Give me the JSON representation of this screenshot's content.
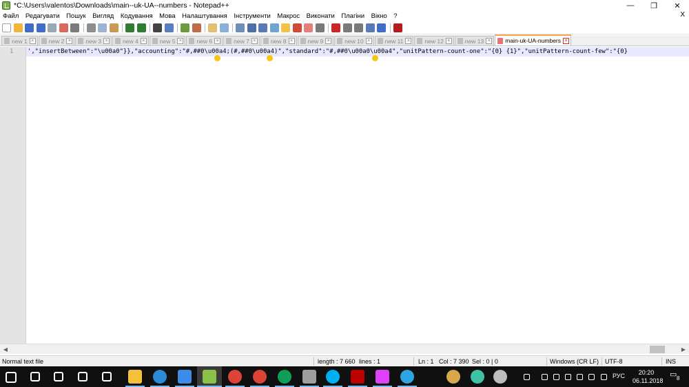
{
  "window": {
    "title": "*C:\\Users\\valentos\\Downloads\\main--uk-UA--numbers - Notepad++",
    "controls": [
      "—",
      "❐",
      "✕"
    ]
  },
  "menu": {
    "items": [
      "Файл",
      "Редагувати",
      "Пошук",
      "Вигляд",
      "Кодування",
      "Мова",
      "Налаштування",
      "Інструменти",
      "Макрос",
      "Виконати",
      "Плагіни",
      "Вікно",
      "?"
    ],
    "close": "X"
  },
  "toolbar": {
    "buttons": [
      {
        "name": "new-file-icon",
        "color": "#ffffff"
      },
      {
        "name": "open-file-icon",
        "color": "#f0b53c"
      },
      {
        "name": "save-icon",
        "color": "#3f6ec6"
      },
      {
        "name": "save-all-icon",
        "color": "#3f6ec6"
      },
      {
        "name": "close-icon",
        "color": "#9aa7b4"
      },
      {
        "name": "close-all-icon",
        "color": "#d96b5d"
      },
      {
        "name": "print-icon",
        "color": "#7a7a7a"
      },
      {
        "sep": true
      },
      {
        "name": "cut-icon",
        "color": "#8d8d8d"
      },
      {
        "name": "copy-icon",
        "color": "#9cb3d6"
      },
      {
        "name": "paste-icon",
        "color": "#c89a52"
      },
      {
        "sep": true
      },
      {
        "name": "undo-icon",
        "color": "#2e7d32"
      },
      {
        "name": "redo-icon",
        "color": "#2e7d32"
      },
      {
        "sep": true
      },
      {
        "name": "find-icon",
        "color": "#444444"
      },
      {
        "name": "replace-icon",
        "color": "#5a7fc0"
      },
      {
        "sep": true
      },
      {
        "name": "zoom-in-icon",
        "color": "#6d9a3a"
      },
      {
        "name": "zoom-out-icon",
        "color": "#c06a48"
      },
      {
        "sep": true
      },
      {
        "name": "sync-vertical-icon",
        "color": "#e3c070"
      },
      {
        "name": "sync-horizontal-icon",
        "color": "#8ab0d8"
      },
      {
        "sep": true
      },
      {
        "name": "word-wrap-icon",
        "color": "#6e8fb8"
      },
      {
        "name": "show-all-chars-icon",
        "color": "#4c6fa8"
      },
      {
        "name": "indent-guide-icon",
        "color": "#5a79b8"
      },
      {
        "name": "udl-icon",
        "color": "#6fa3d0"
      },
      {
        "name": "doc-map-icon",
        "color": "#f1c24a"
      },
      {
        "name": "function-list-icon",
        "color": "#d04a3a"
      },
      {
        "name": "folder-workspace-icon",
        "color": "#e77e7e"
      },
      {
        "name": "monitoring-icon",
        "color": "#7a7a7a"
      },
      {
        "sep": true
      },
      {
        "name": "record-macro-icon",
        "color": "#c62828"
      },
      {
        "name": "stop-macro-icon",
        "color": "#7a7a7a"
      },
      {
        "name": "play-macro-icon",
        "color": "#7a7a7a"
      },
      {
        "name": "play-multiple-icon",
        "color": "#5a79b8"
      },
      {
        "name": "save-macro-icon",
        "color": "#3f6ec6"
      },
      {
        "sep": true
      },
      {
        "name": "spellcheck-icon",
        "color": "#b71c1c"
      }
    ]
  },
  "tabs": [
    {
      "label": "new 1",
      "active": false
    },
    {
      "label": "new 2",
      "active": false
    },
    {
      "label": "new 3",
      "active": false
    },
    {
      "label": "new 4",
      "active": false
    },
    {
      "label": "new 5",
      "active": false
    },
    {
      "label": "new 6",
      "active": false
    },
    {
      "label": "new 7",
      "active": false
    },
    {
      "label": "new 8",
      "active": false
    },
    {
      "label": "new 9",
      "active": false
    },
    {
      "label": "new 10",
      "active": false
    },
    {
      "label": "new 11",
      "active": false
    },
    {
      "label": "new 12",
      "active": false
    },
    {
      "label": "new 13",
      "active": false
    },
    {
      "label": "main-uk-UA-numbers",
      "active": true
    }
  ],
  "editor": {
    "line_number": "1",
    "line_text": "',\"insertBetween\":\"\\u00a0\"}},\"accounting\":\"#,##0\\u00a4;(#,##0\\u00a4)\",\"standard\":\"#,##0\\u00a0\\u00a4\",\"unitPattern-count-one\":\"{0} {1}\",\"unitPattern-count-few\":\"{0}",
    "marker_color": "#f6c611"
  },
  "status": {
    "file_type": "Normal text file",
    "length": "length : 7 660",
    "lines": "lines : 1",
    "ln": "Ln : 1",
    "col": "Col : 7 390",
    "sel": "Sel : 0 | 0",
    "eol": "Windows (CR LF)",
    "encoding": "UTF-8",
    "mode": "INS"
  },
  "taskbar": {
    "apps": [
      {
        "name": "windows-start-icon",
        "color": "#ffffff"
      },
      {
        "name": "search-icon",
        "color": "#ffffff"
      },
      {
        "name": "task-view-icon",
        "color": "#ffffff"
      },
      {
        "name": "store-icon",
        "color": "#ffffff"
      },
      {
        "name": "calculator-icon",
        "color": "#ffffff"
      },
      {
        "name": "file-explorer-icon",
        "color": "#f3c13a"
      },
      {
        "name": "edge-icon",
        "color": "#2b8bd8"
      },
      {
        "name": "todo-icon",
        "color": "#3d8be8"
      },
      {
        "name": "notepadpp-icon",
        "color": "#8bc34a"
      },
      {
        "name": "chrome-icon",
        "color": "#db4437"
      },
      {
        "name": "chrome-profile-2-icon",
        "color": "#db4437"
      },
      {
        "name": "chrome-profile-3-icon",
        "color": "#0f9d58"
      },
      {
        "name": "remote-desktop-icon",
        "color": "#9e9e9e"
      },
      {
        "name": "skype-icon",
        "color": "#00aff0"
      },
      {
        "name": "filezilla-icon",
        "color": "#bf0000"
      },
      {
        "name": "audio-app-icon",
        "color": "#e040fb"
      },
      {
        "name": "telegram-icon",
        "color": "#2ca5e0"
      }
    ],
    "tray_icons": [
      "tray-app-1-icon",
      "tray-app-2-icon",
      "tray-app-3-icon",
      "people-icon",
      "chevron-up-icon",
      "cloud-icon",
      "network-icon",
      "battery-icon",
      "volume-icon",
      "keyboard-icon"
    ],
    "lang": "РУС",
    "time": "20:20",
    "date": "06.11.2018",
    "notifications": "8"
  }
}
